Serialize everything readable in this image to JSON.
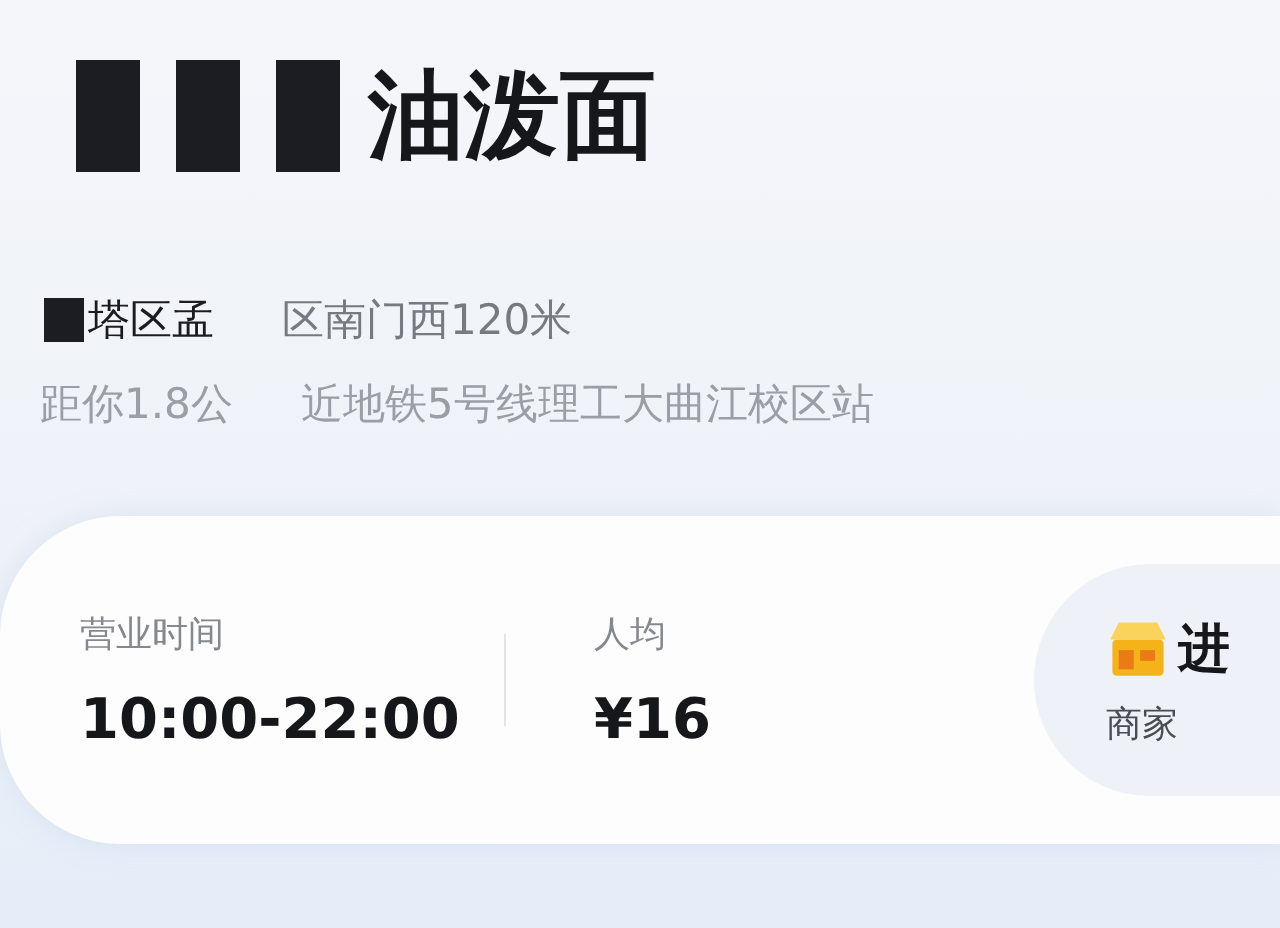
{
  "shop": {
    "title": "油泼面",
    "address_parts": [
      "塔区孟",
      "区南门西120米"
    ],
    "distance_parts": [
      "距你1.8公",
      "近地铁5号线理工大曲江校区站"
    ]
  },
  "info_card": {
    "fields": [
      {
        "label": "营业时间",
        "value": "10:00-22:00"
      },
      {
        "label": "人均",
        "value": "¥16"
      }
    ],
    "shop_button": {
      "title": "进",
      "subtitle": "商家"
    }
  }
}
